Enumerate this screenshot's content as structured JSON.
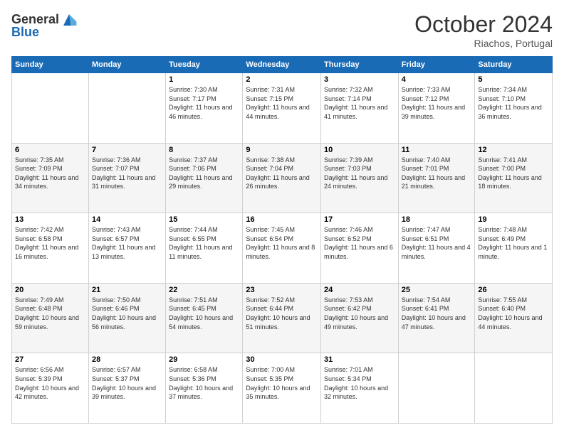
{
  "header": {
    "logo_general": "General",
    "logo_blue": "Blue",
    "month_title": "October 2024",
    "location": "Riachos, Portugal"
  },
  "weekdays": [
    "Sunday",
    "Monday",
    "Tuesday",
    "Wednesday",
    "Thursday",
    "Friday",
    "Saturday"
  ],
  "weeks": [
    [
      {
        "day": "",
        "sunrise": "",
        "sunset": "",
        "daylight": ""
      },
      {
        "day": "",
        "sunrise": "",
        "sunset": "",
        "daylight": ""
      },
      {
        "day": "1",
        "sunrise": "Sunrise: 7:30 AM",
        "sunset": "Sunset: 7:17 PM",
        "daylight": "Daylight: 11 hours and 46 minutes."
      },
      {
        "day": "2",
        "sunrise": "Sunrise: 7:31 AM",
        "sunset": "Sunset: 7:15 PM",
        "daylight": "Daylight: 11 hours and 44 minutes."
      },
      {
        "day": "3",
        "sunrise": "Sunrise: 7:32 AM",
        "sunset": "Sunset: 7:14 PM",
        "daylight": "Daylight: 11 hours and 41 minutes."
      },
      {
        "day": "4",
        "sunrise": "Sunrise: 7:33 AM",
        "sunset": "Sunset: 7:12 PM",
        "daylight": "Daylight: 11 hours and 39 minutes."
      },
      {
        "day": "5",
        "sunrise": "Sunrise: 7:34 AM",
        "sunset": "Sunset: 7:10 PM",
        "daylight": "Daylight: 11 hours and 36 minutes."
      }
    ],
    [
      {
        "day": "6",
        "sunrise": "Sunrise: 7:35 AM",
        "sunset": "Sunset: 7:09 PM",
        "daylight": "Daylight: 11 hours and 34 minutes."
      },
      {
        "day": "7",
        "sunrise": "Sunrise: 7:36 AM",
        "sunset": "Sunset: 7:07 PM",
        "daylight": "Daylight: 11 hours and 31 minutes."
      },
      {
        "day": "8",
        "sunrise": "Sunrise: 7:37 AM",
        "sunset": "Sunset: 7:06 PM",
        "daylight": "Daylight: 11 hours and 29 minutes."
      },
      {
        "day": "9",
        "sunrise": "Sunrise: 7:38 AM",
        "sunset": "Sunset: 7:04 PM",
        "daylight": "Daylight: 11 hours and 26 minutes."
      },
      {
        "day": "10",
        "sunrise": "Sunrise: 7:39 AM",
        "sunset": "Sunset: 7:03 PM",
        "daylight": "Daylight: 11 hours and 24 minutes."
      },
      {
        "day": "11",
        "sunrise": "Sunrise: 7:40 AM",
        "sunset": "Sunset: 7:01 PM",
        "daylight": "Daylight: 11 hours and 21 minutes."
      },
      {
        "day": "12",
        "sunrise": "Sunrise: 7:41 AM",
        "sunset": "Sunset: 7:00 PM",
        "daylight": "Daylight: 11 hours and 18 minutes."
      }
    ],
    [
      {
        "day": "13",
        "sunrise": "Sunrise: 7:42 AM",
        "sunset": "Sunset: 6:58 PM",
        "daylight": "Daylight: 11 hours and 16 minutes."
      },
      {
        "day": "14",
        "sunrise": "Sunrise: 7:43 AM",
        "sunset": "Sunset: 6:57 PM",
        "daylight": "Daylight: 11 hours and 13 minutes."
      },
      {
        "day": "15",
        "sunrise": "Sunrise: 7:44 AM",
        "sunset": "Sunset: 6:55 PM",
        "daylight": "Daylight: 11 hours and 11 minutes."
      },
      {
        "day": "16",
        "sunrise": "Sunrise: 7:45 AM",
        "sunset": "Sunset: 6:54 PM",
        "daylight": "Daylight: 11 hours and 8 minutes."
      },
      {
        "day": "17",
        "sunrise": "Sunrise: 7:46 AM",
        "sunset": "Sunset: 6:52 PM",
        "daylight": "Daylight: 11 hours and 6 minutes."
      },
      {
        "day": "18",
        "sunrise": "Sunrise: 7:47 AM",
        "sunset": "Sunset: 6:51 PM",
        "daylight": "Daylight: 11 hours and 4 minutes."
      },
      {
        "day": "19",
        "sunrise": "Sunrise: 7:48 AM",
        "sunset": "Sunset: 6:49 PM",
        "daylight": "Daylight: 11 hours and 1 minute."
      }
    ],
    [
      {
        "day": "20",
        "sunrise": "Sunrise: 7:49 AM",
        "sunset": "Sunset: 6:48 PM",
        "daylight": "Daylight: 10 hours and 59 minutes."
      },
      {
        "day": "21",
        "sunrise": "Sunrise: 7:50 AM",
        "sunset": "Sunset: 6:46 PM",
        "daylight": "Daylight: 10 hours and 56 minutes."
      },
      {
        "day": "22",
        "sunrise": "Sunrise: 7:51 AM",
        "sunset": "Sunset: 6:45 PM",
        "daylight": "Daylight: 10 hours and 54 minutes."
      },
      {
        "day": "23",
        "sunrise": "Sunrise: 7:52 AM",
        "sunset": "Sunset: 6:44 PM",
        "daylight": "Daylight: 10 hours and 51 minutes."
      },
      {
        "day": "24",
        "sunrise": "Sunrise: 7:53 AM",
        "sunset": "Sunset: 6:42 PM",
        "daylight": "Daylight: 10 hours and 49 minutes."
      },
      {
        "day": "25",
        "sunrise": "Sunrise: 7:54 AM",
        "sunset": "Sunset: 6:41 PM",
        "daylight": "Daylight: 10 hours and 47 minutes."
      },
      {
        "day": "26",
        "sunrise": "Sunrise: 7:55 AM",
        "sunset": "Sunset: 6:40 PM",
        "daylight": "Daylight: 10 hours and 44 minutes."
      }
    ],
    [
      {
        "day": "27",
        "sunrise": "Sunrise: 6:56 AM",
        "sunset": "Sunset: 5:39 PM",
        "daylight": "Daylight: 10 hours and 42 minutes."
      },
      {
        "day": "28",
        "sunrise": "Sunrise: 6:57 AM",
        "sunset": "Sunset: 5:37 PM",
        "daylight": "Daylight: 10 hours and 39 minutes."
      },
      {
        "day": "29",
        "sunrise": "Sunrise: 6:58 AM",
        "sunset": "Sunset: 5:36 PM",
        "daylight": "Daylight: 10 hours and 37 minutes."
      },
      {
        "day": "30",
        "sunrise": "Sunrise: 7:00 AM",
        "sunset": "Sunset: 5:35 PM",
        "daylight": "Daylight: 10 hours and 35 minutes."
      },
      {
        "day": "31",
        "sunrise": "Sunrise: 7:01 AM",
        "sunset": "Sunset: 5:34 PM",
        "daylight": "Daylight: 10 hours and 32 minutes."
      },
      {
        "day": "",
        "sunrise": "",
        "sunset": "",
        "daylight": ""
      },
      {
        "day": "",
        "sunrise": "",
        "sunset": "",
        "daylight": ""
      }
    ]
  ]
}
